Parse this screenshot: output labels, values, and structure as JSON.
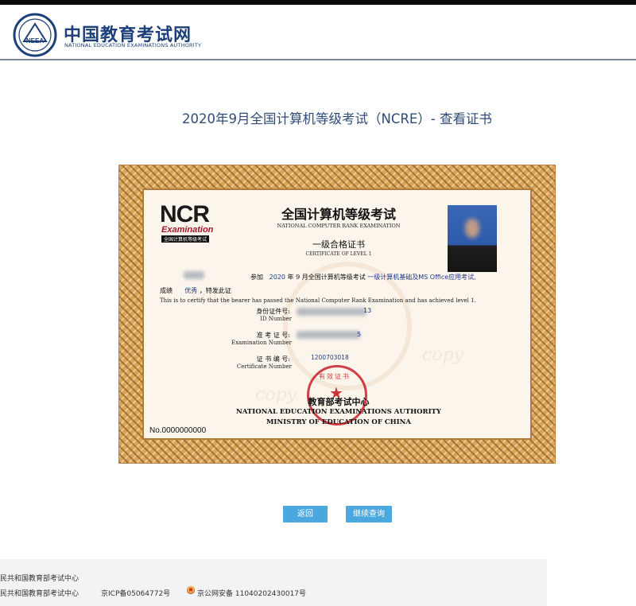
{
  "header": {
    "logo_cn": "中国教育考试网",
    "logo_en": "NATIONAL EDUCATION EXAMINATIONS AUTHORITY",
    "seal_text": "NEEA"
  },
  "page": {
    "title": "2020年9月全国计算机等级考试（NCRE）- 查看证书"
  },
  "certificate": {
    "logo_word": "NCR",
    "logo_exam": "Examination",
    "logo_sub": "全国计算机等级考试",
    "title_cn": "全国计算机等级考试",
    "title_en": "NATIONAL COMPUTER RANK EXAMINATION",
    "level_cn": "一级合格证书",
    "level_en": "CERTIFICATE OF LEVEL 1",
    "line1_prefix": "参加",
    "line1_year": "2020",
    "line1_mid": "年 9 月全国计算机等级考试",
    "line1_subject": "一级计算机基础及MS Office应用考试,",
    "line2_prefix": "成绩",
    "line2_grade": "优秀",
    "line2_suffix": "，特发此证",
    "line3_en": "This is to certify that the bearer has passed the National Computer Rank Examination and has achieved level 1.",
    "id_label_cn": "身份证件号:",
    "id_label_en": "ID Number",
    "id_value_tail": "13",
    "exam_label_cn": "准 考 证 号:",
    "exam_label_en": "Examination Number",
    "exam_value_tail": "5",
    "cert_label_cn": "证 书 编 号:",
    "cert_label_en": "Certificate Number",
    "cert_value": "1200703018",
    "authority_cn": "教育部考试中心",
    "authority_en1": "NATIONAL EDUCATION EXAMINATIONS AUTHORITY",
    "authority_en2": "MINISTRY OF EDUCATION OF CHINA",
    "cert_no": "No.0000000000",
    "stamp_text": "有效证书"
  },
  "buttons": {
    "back": "返回",
    "continue": "继续查询"
  },
  "footer": {
    "line1": "民共和国教育部考试中心",
    "line2": "民共和国教育部考试中心",
    "icp": "京ICP备05064772号",
    "police": "京公网安备 11040202430017号"
  }
}
